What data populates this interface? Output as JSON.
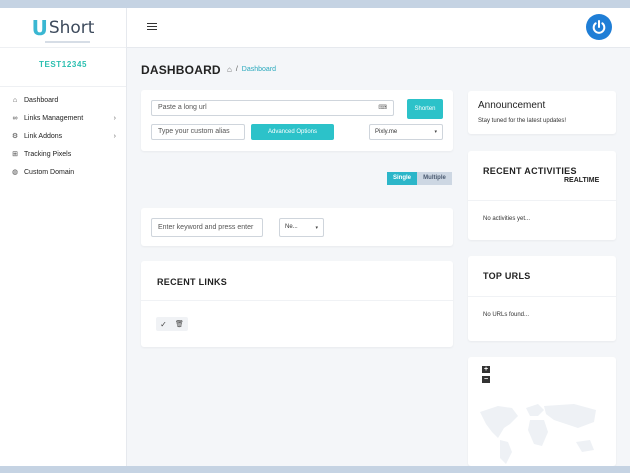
{
  "app": {
    "logo_letter": "U",
    "logo_text": "Short"
  },
  "user": {
    "name": "TEST12345"
  },
  "sidebar": {
    "items": [
      {
        "label": "Dashboard",
        "icon": "home-icon",
        "glyph": "⌂",
        "chevron": ""
      },
      {
        "label": "Links Management",
        "icon": "link-icon",
        "glyph": "∞",
        "chevron": "›"
      },
      {
        "label": "Link Addons",
        "icon": "gear-icon",
        "glyph": "⚙",
        "chevron": "›"
      },
      {
        "label": "Tracking Pixels",
        "icon": "grid-icon",
        "glyph": "⊞",
        "chevron": ""
      },
      {
        "label": "Custom Domain",
        "icon": "globe-icon",
        "glyph": "◍",
        "chevron": ""
      }
    ]
  },
  "header": {
    "title": "DASHBOARD",
    "breadcrumb_sep": "/",
    "breadcrumb_link": "Dashboard"
  },
  "shorten": {
    "url_placeholder": "Paste a long url",
    "alias_placeholder": "Type your custom alias",
    "shorten_label": "Shorten",
    "advanced_label": "Advanced Options",
    "domain_value": "Pixly.me"
  },
  "mode": {
    "single": "Single",
    "multiple": "Multiple"
  },
  "search": {
    "placeholder": "Enter keyword and press enter",
    "filter_value": "Ne..."
  },
  "recent_links": {
    "title": "RECENT LINKS"
  },
  "announcement": {
    "title": "Announcement",
    "text": "Stay tuned for the latest updates!"
  },
  "activities": {
    "title": "RECENT ACTIVITIES",
    "subtitle": "REALTIME",
    "empty": "No activities yet..."
  },
  "top_urls": {
    "title": "TOP URLS",
    "empty": "No URLs found..."
  },
  "map": {
    "zoom_in": "+",
    "zoom_out": "−"
  },
  "colors": {
    "accent": "#2cc2c9",
    "brand": "#1f7ed6",
    "user": "#2bbfb0"
  }
}
